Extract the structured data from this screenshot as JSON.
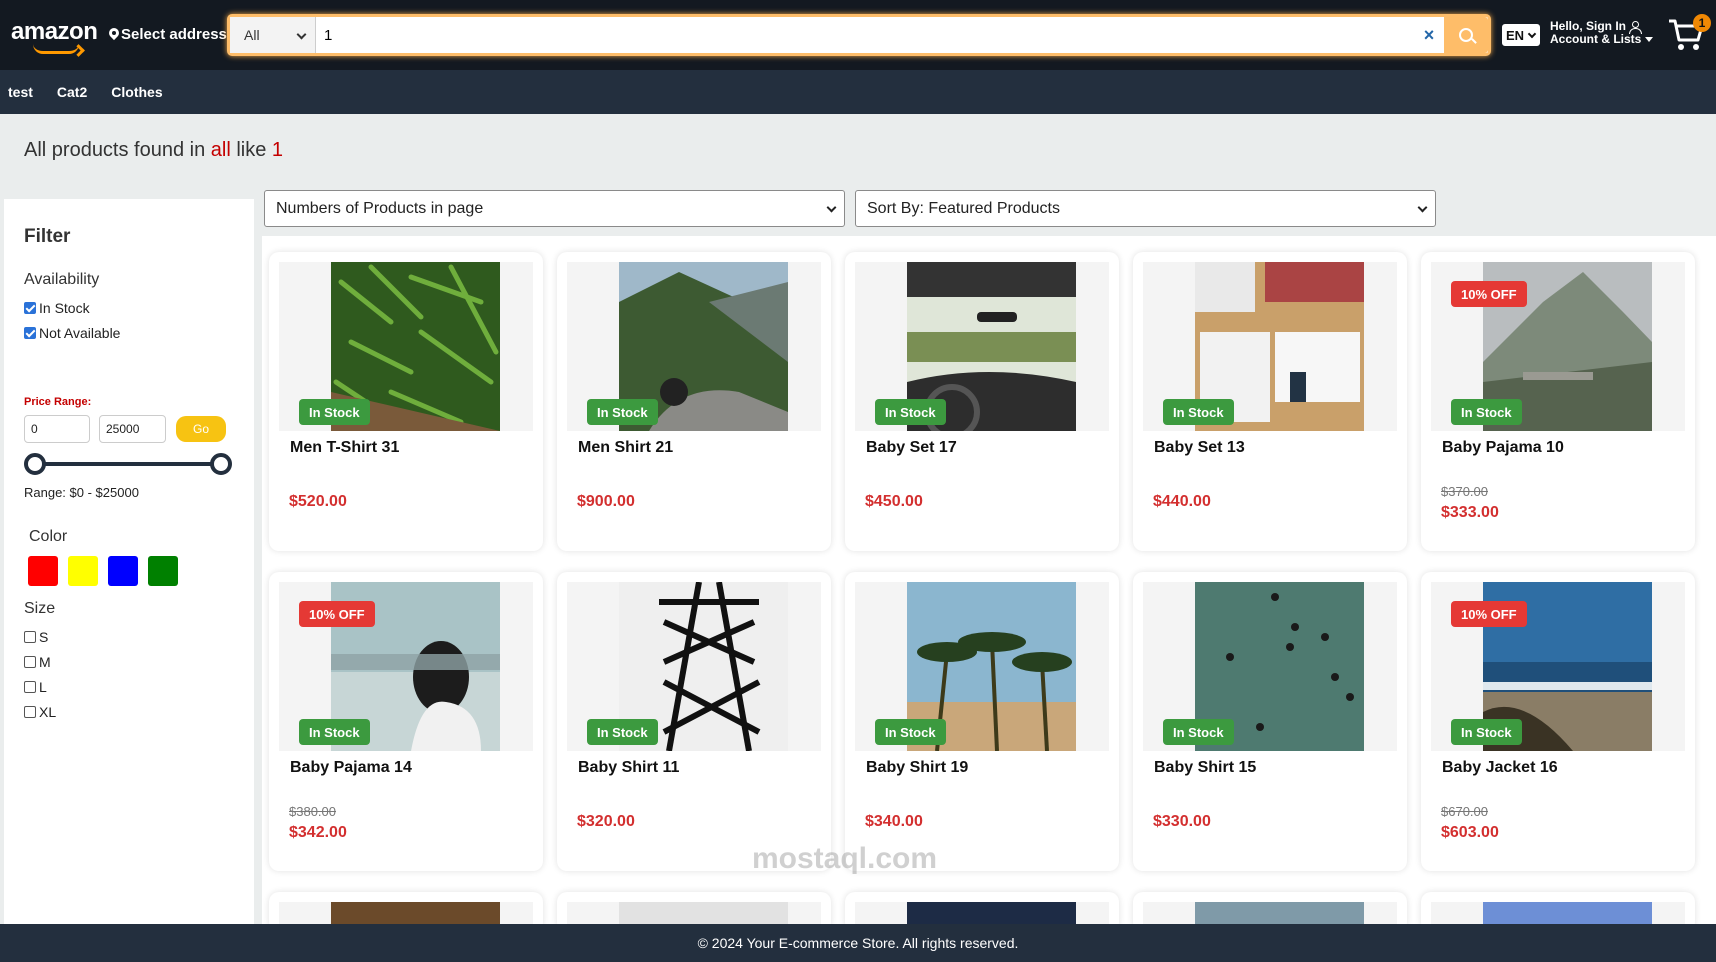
{
  "header": {
    "logo": "amazon",
    "address": "Select address",
    "search": {
      "category": "All",
      "value": "1",
      "clear": "×"
    },
    "language": "EN",
    "account_line1": "Hello, Sign In",
    "account_line2": "Account & Lists",
    "cart_count": "1"
  },
  "nav": [
    "test",
    "Cat2",
    "Clothes"
  ],
  "results": {
    "prefix": "All products found in ",
    "category": "all",
    "middle": " like ",
    "query": "1"
  },
  "filter": {
    "title": "Filter",
    "availability_label": "Availability",
    "availability": [
      {
        "label": "In Stock",
        "checked": true
      },
      {
        "label": "Not Available",
        "checked": true
      }
    ],
    "price_label": "Price Range:",
    "min": "0",
    "max": "25000",
    "go": "Go",
    "range_text": "Range: $0 - $25000",
    "color_label": "Color",
    "colors": [
      "#ff0000",
      "#ffff00",
      "#0000ff",
      "#008000"
    ],
    "size_label": "Size",
    "sizes": [
      "S",
      "M",
      "L",
      "XL"
    ]
  },
  "controls": {
    "per_page": "Numbers of Products in page",
    "sort": "Sort By: Featured Products"
  },
  "stock_label": "In Stock",
  "products": [
    {
      "name": "Men T-Shirt 31",
      "price": "$520.00"
    },
    {
      "name": "Men Shirt 21",
      "price": "$900.00"
    },
    {
      "name": "Baby Set 17",
      "price": "$450.00"
    },
    {
      "name": "Baby Set 13",
      "price": "$440.00"
    },
    {
      "name": "Baby Pajama 10",
      "price": "$333.00",
      "old_price": "$370.00",
      "discount": "10% OFF"
    },
    {
      "name": "Baby Pajama 14",
      "price": "$342.00",
      "old_price": "$380.00",
      "discount": "10% OFF"
    },
    {
      "name": "Baby Shirt 11",
      "price": "$320.00"
    },
    {
      "name": "Baby Shirt 19",
      "price": "$340.00"
    },
    {
      "name": "Baby Shirt 15",
      "price": "$330.00"
    },
    {
      "name": "Baby Jacket 16",
      "price": "$603.00",
      "old_price": "$670.00",
      "discount": "10% OFF"
    }
  ],
  "footer": "© 2024 Your E-commerce Store. All rights reserved.",
  "watermark": "mostaql.com"
}
